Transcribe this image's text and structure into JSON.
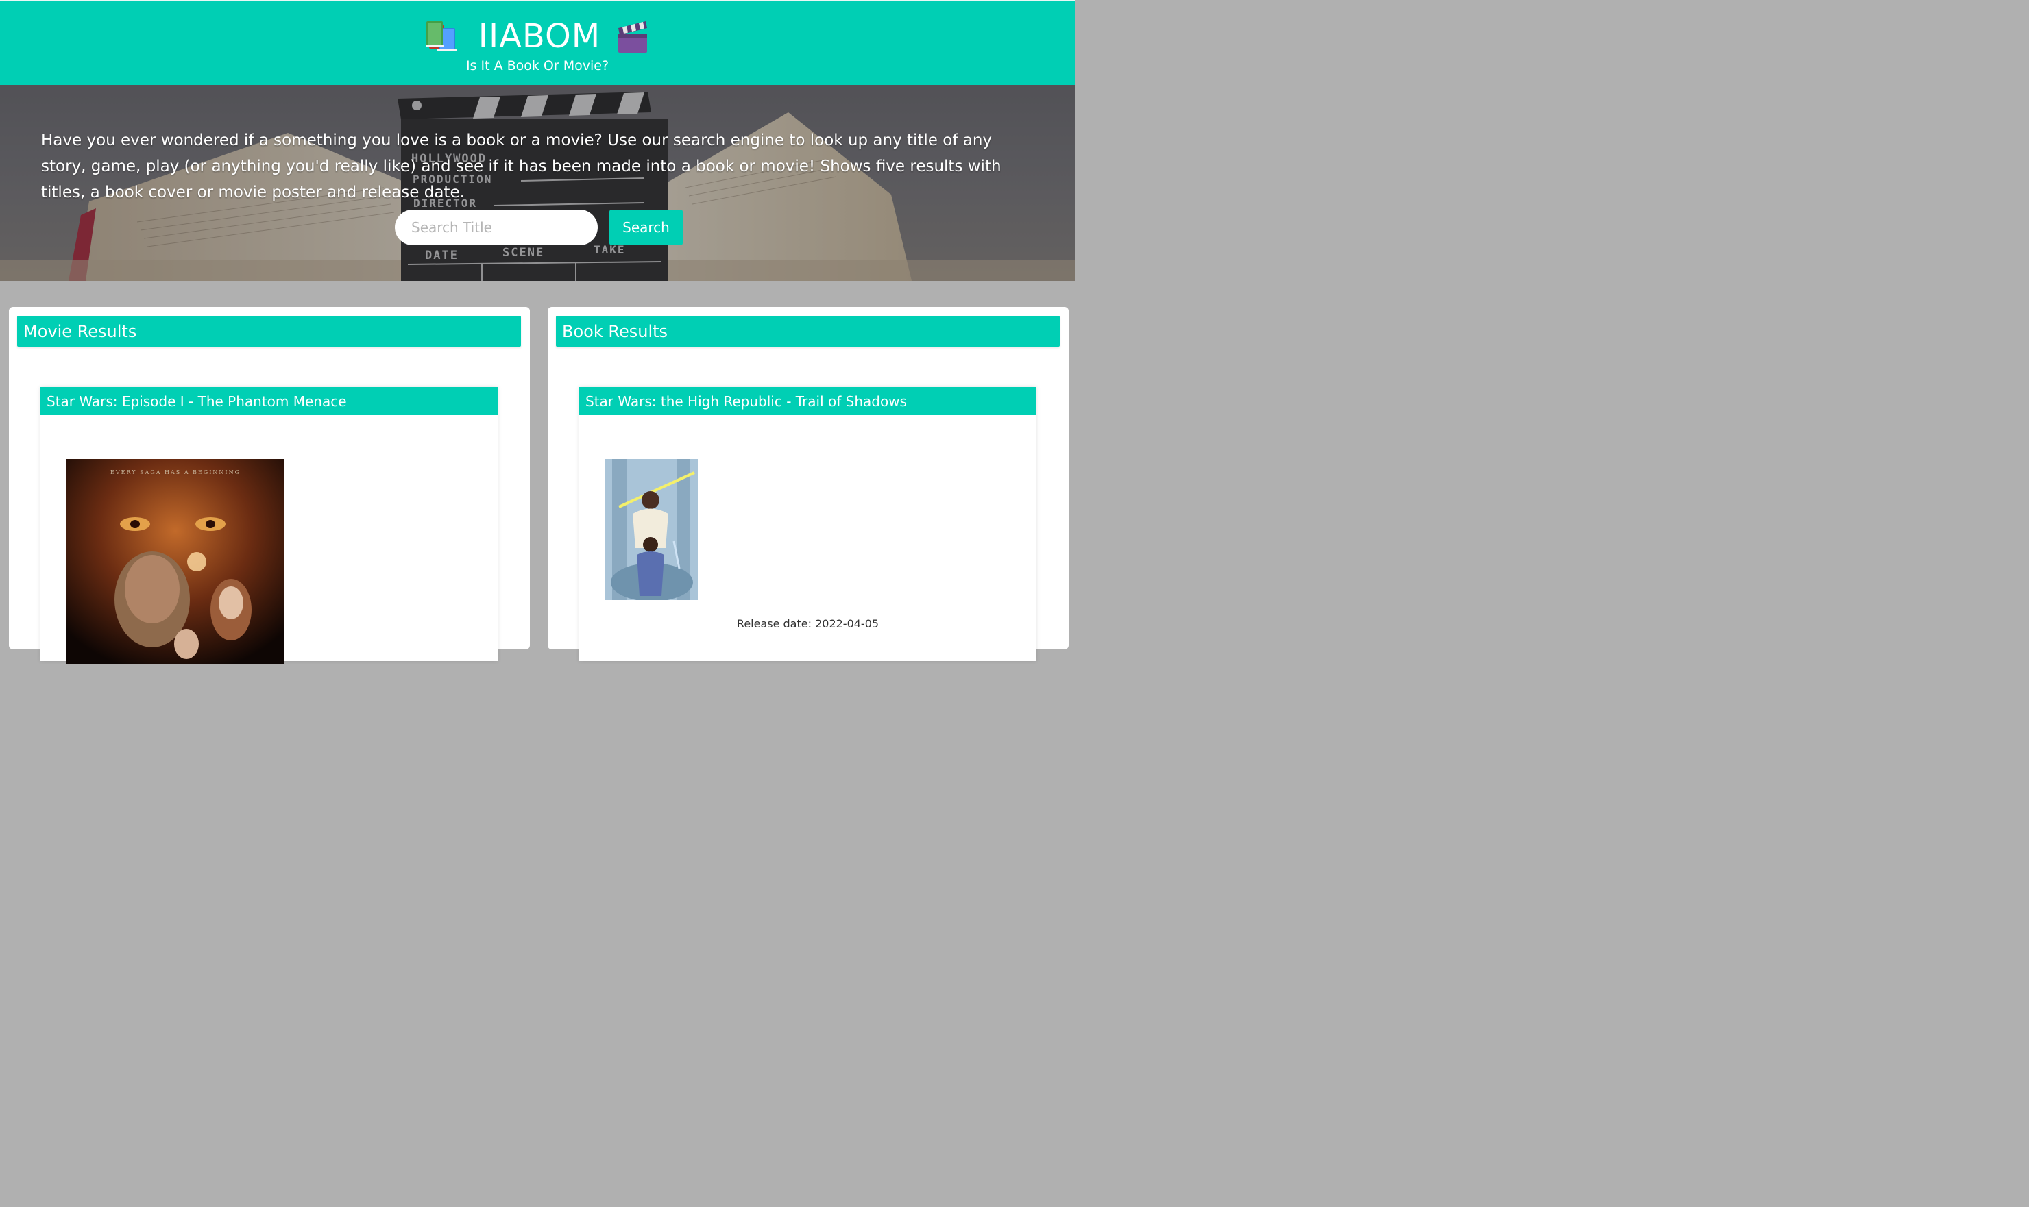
{
  "header": {
    "title": "IIABOM",
    "subtitle": "Is It A Book Or Movie?",
    "left_icon": "books-emoji-icon",
    "right_icon": "clapper-board-emoji-icon"
  },
  "hero": {
    "description": "Have you ever wondered if a something you love is a book or a movie? Use our search engine to look up any title of any story, game, play (or anything you'd really like) and see if it has been made into a book or movie! Shows five results with titles, a book cover or movie poster and release date.",
    "clapper_text": {
      "hollywood": "HOLLYWOOD",
      "production": "PRODUCTION",
      "director": "DIRECTOR",
      "date": "DATE",
      "scene": "SCENE",
      "take": "TAKE"
    }
  },
  "search": {
    "placeholder": "Search Title",
    "value": "",
    "button_label": "Search"
  },
  "movie_panel": {
    "heading": "Movie Results",
    "results": [
      {
        "title": "Star Wars: Episode I - The Phantom Menace",
        "poster_tagline": "EVERY SAGA HAS A BEGINNING"
      }
    ]
  },
  "book_panel": {
    "heading": "Book Results",
    "results": [
      {
        "title": "Star Wars: the High Republic - Trail of Shadows",
        "release_date": "Release date: 2022-04-05"
      }
    ]
  },
  "colors": {
    "accent": "#00cfb4",
    "page_background": "#b0b0b0",
    "panel_background": "#ffffff"
  }
}
